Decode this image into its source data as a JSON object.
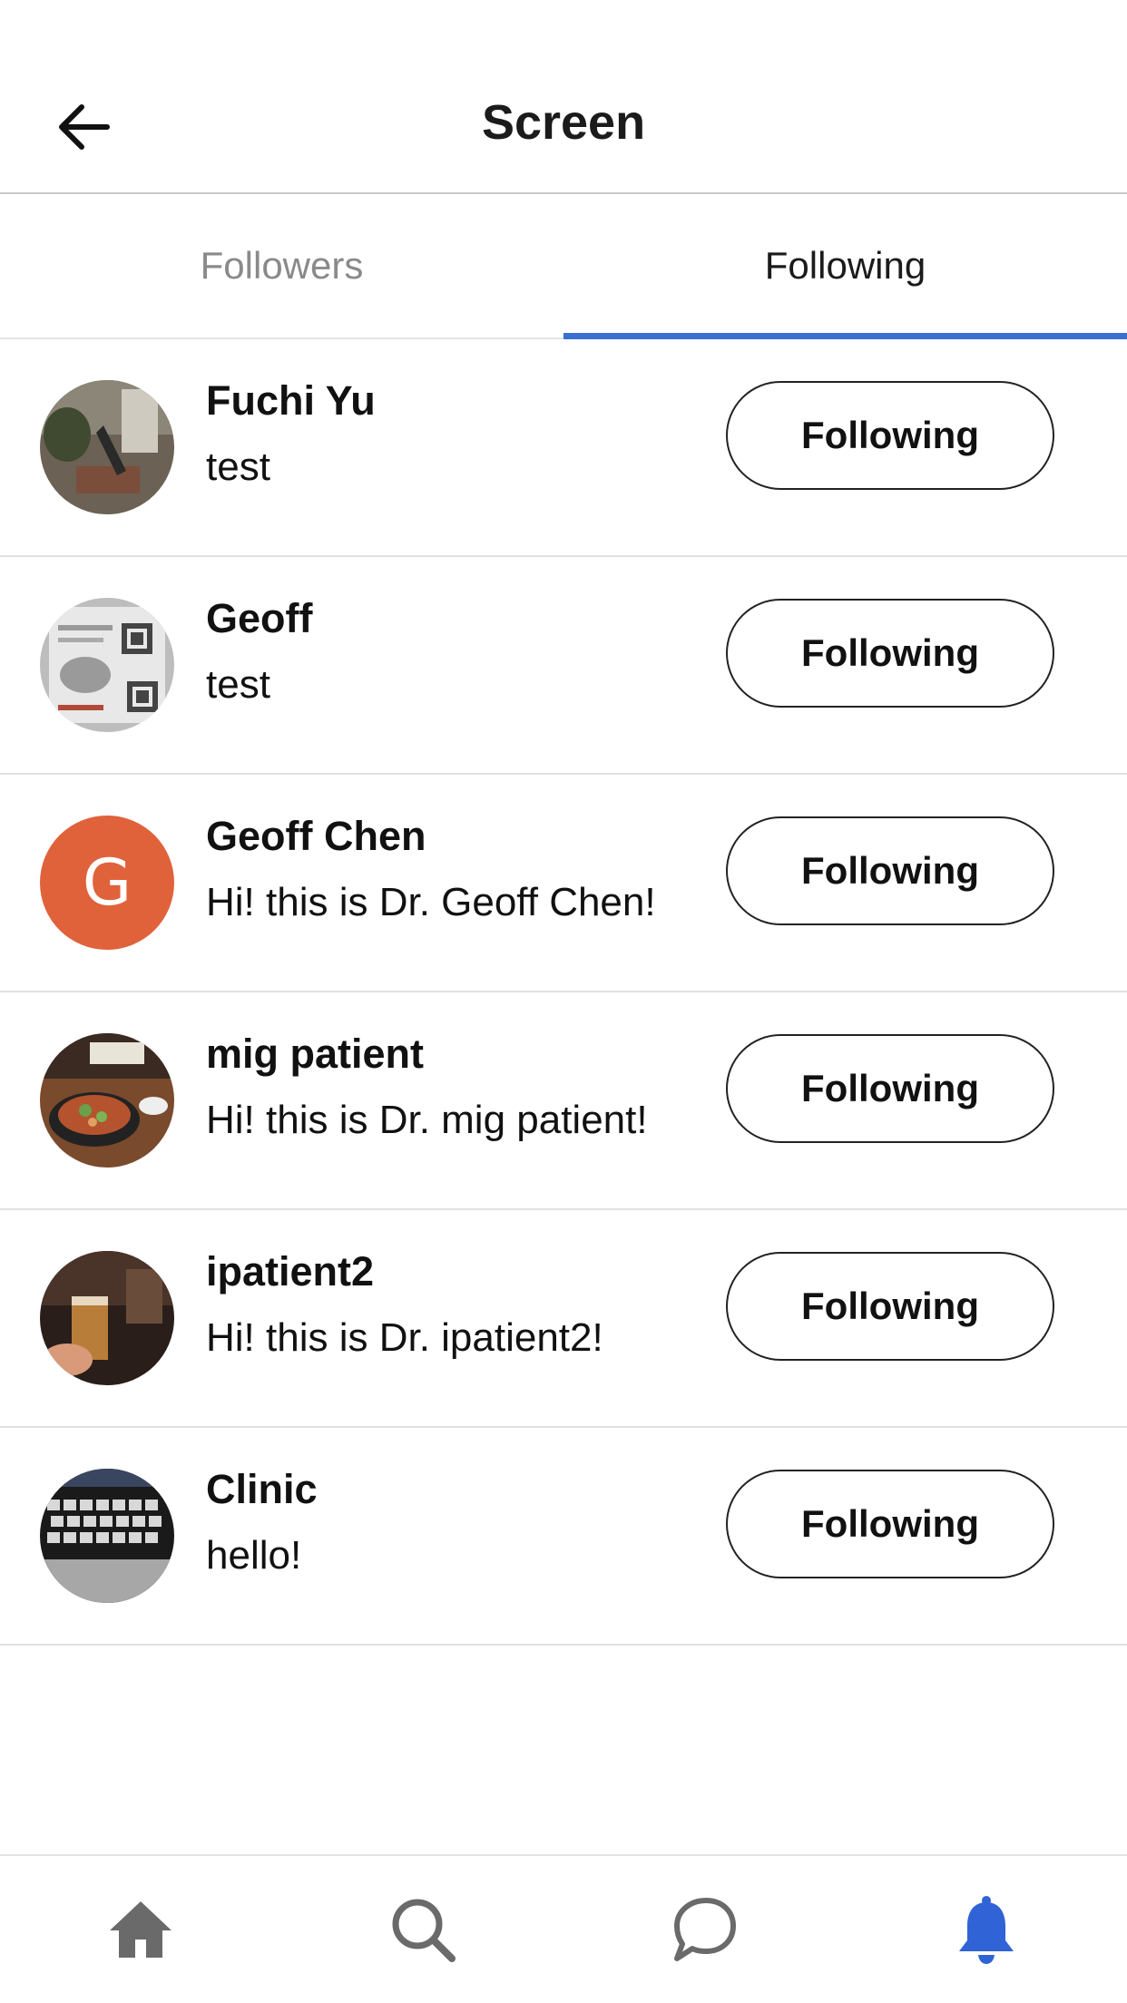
{
  "header": {
    "title": "Screen",
    "back_icon": "arrow-left-icon"
  },
  "tabs": [
    {
      "label": "Followers",
      "active": false
    },
    {
      "label": "Following",
      "active": true
    }
  ],
  "accent_color": "#3a6fd3",
  "users": [
    {
      "name": "Fuchi Yu",
      "bio": "test",
      "button": "Following",
      "avatar": "photo"
    },
    {
      "name": "Geoff",
      "bio": "test",
      "button": "Following",
      "avatar": "photo"
    },
    {
      "name": "Geoff Chen",
      "bio": "Hi! this is Dr. Geoff Chen!",
      "button": "Following",
      "avatar": "letter",
      "avatar_letter": "G",
      "avatar_color": "#e0623b"
    },
    {
      "name": "mig patient",
      "bio": "Hi! this is Dr. mig patient!",
      "button": "Following",
      "avatar": "photo"
    },
    {
      "name": "ipatient2",
      "bio": "Hi! this is Dr. ipatient2!",
      "button": "Following",
      "avatar": "photo"
    },
    {
      "name": "Clinic",
      "bio": "hello!",
      "button": "Following",
      "avatar": "photo"
    }
  ],
  "bottom_nav": [
    {
      "icon": "home-icon",
      "active": false
    },
    {
      "icon": "search-icon",
      "active": false
    },
    {
      "icon": "chat-icon",
      "active": false
    },
    {
      "icon": "bell-icon",
      "active": true
    }
  ]
}
